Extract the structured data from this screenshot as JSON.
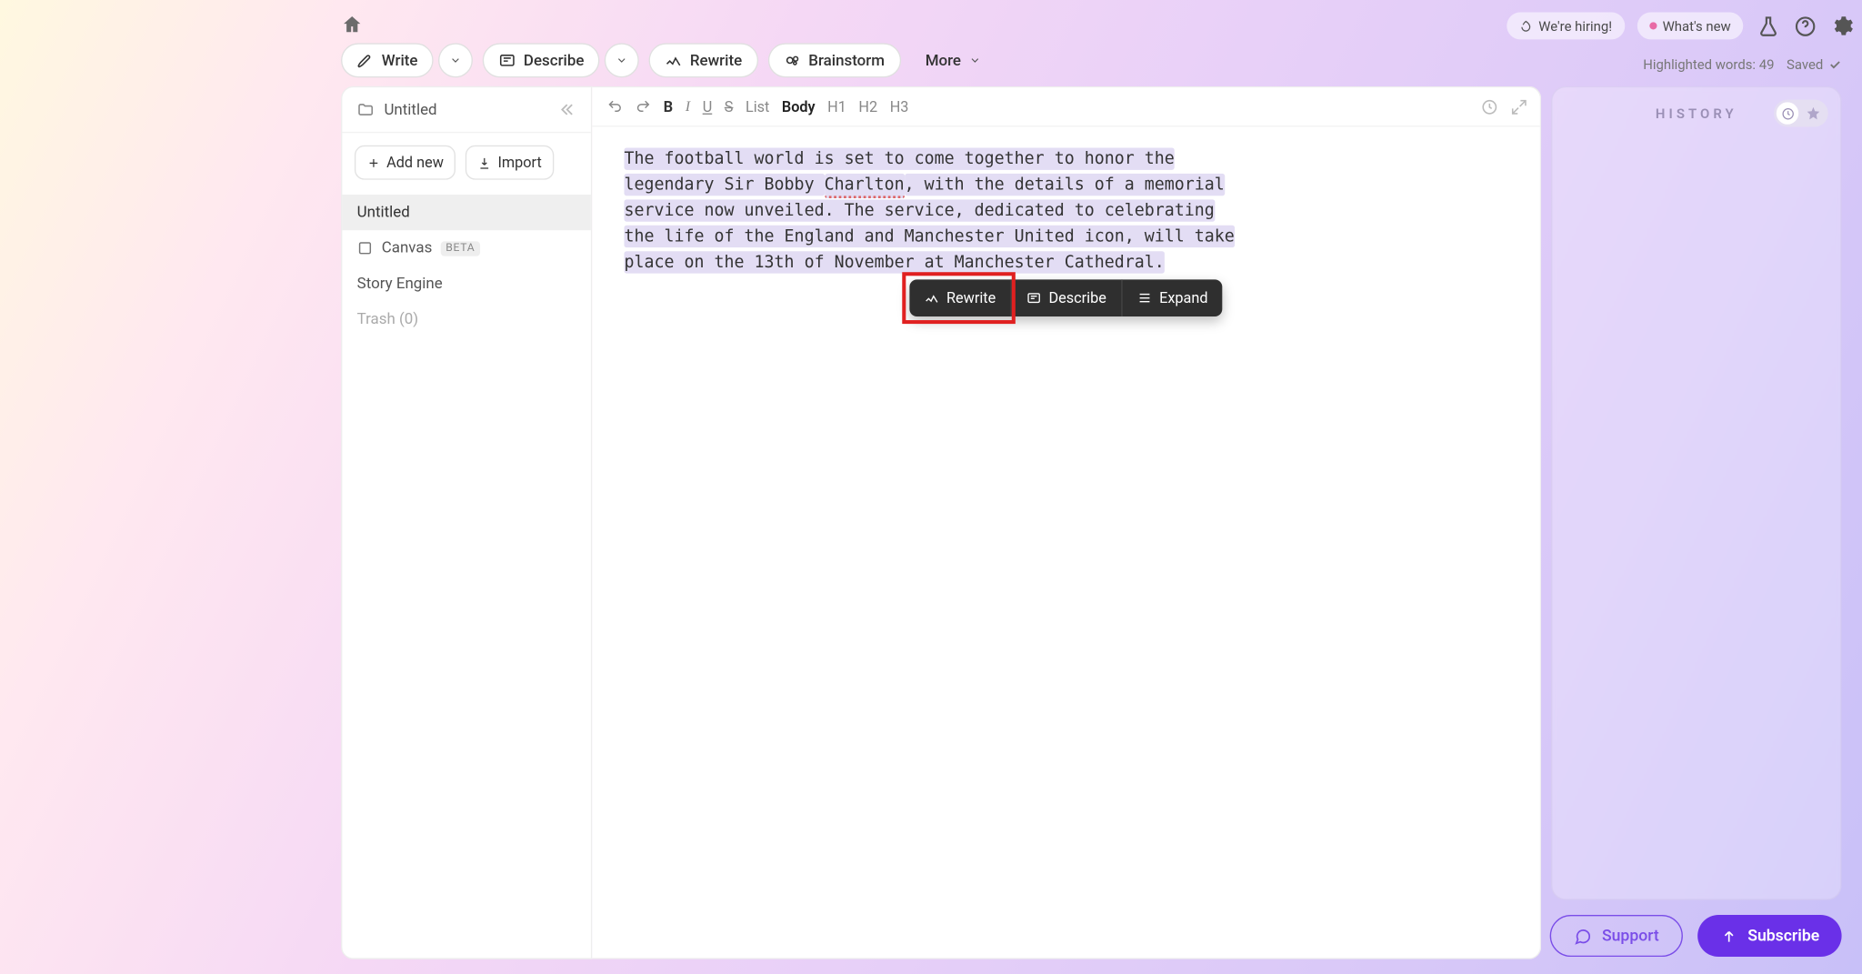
{
  "header": {
    "hiring": "We're hiring!",
    "whatsnew": "What's new"
  },
  "toolbar": {
    "write": "Write",
    "describe": "Describe",
    "rewrite": "Rewrite",
    "brainstorm": "Brainstorm",
    "more": "More"
  },
  "status": {
    "highlighted": "Highlighted words: 49",
    "saved": "Saved"
  },
  "sidebar": {
    "title": "Untitled",
    "add_new": "Add new",
    "import": "Import",
    "items": {
      "untitled": "Untitled",
      "canvas": "Canvas",
      "canvas_badge": "BETA",
      "story_engine": "Story Engine",
      "trash": "Trash (0)"
    }
  },
  "editor_toolbar": {
    "b": "B",
    "i": "I",
    "u": "U",
    "s": "S",
    "list": "List",
    "body": "Body",
    "h1": "H1",
    "h2": "H2",
    "h3": "H3"
  },
  "document": {
    "p1a": "The football world is set to come together to honor the ",
    "p1b": "legendary Sir Bobby ",
    "p1c": "Charlton",
    "p1d": ", with the details of a memorial ",
    "p1e": "service now unveiled. The service, dedicated to celebrating ",
    "p1f": "the life of the England and Manchester United icon, will take ",
    "p1g": "place on the 13th of November at Manchester Cathedral."
  },
  "float_menu": {
    "rewrite": "Rewrite",
    "describe": "Describe",
    "expand": "Expand"
  },
  "history": {
    "title": "HISTORY"
  },
  "footer": {
    "support": "Support",
    "subscribe": "Subscribe"
  }
}
